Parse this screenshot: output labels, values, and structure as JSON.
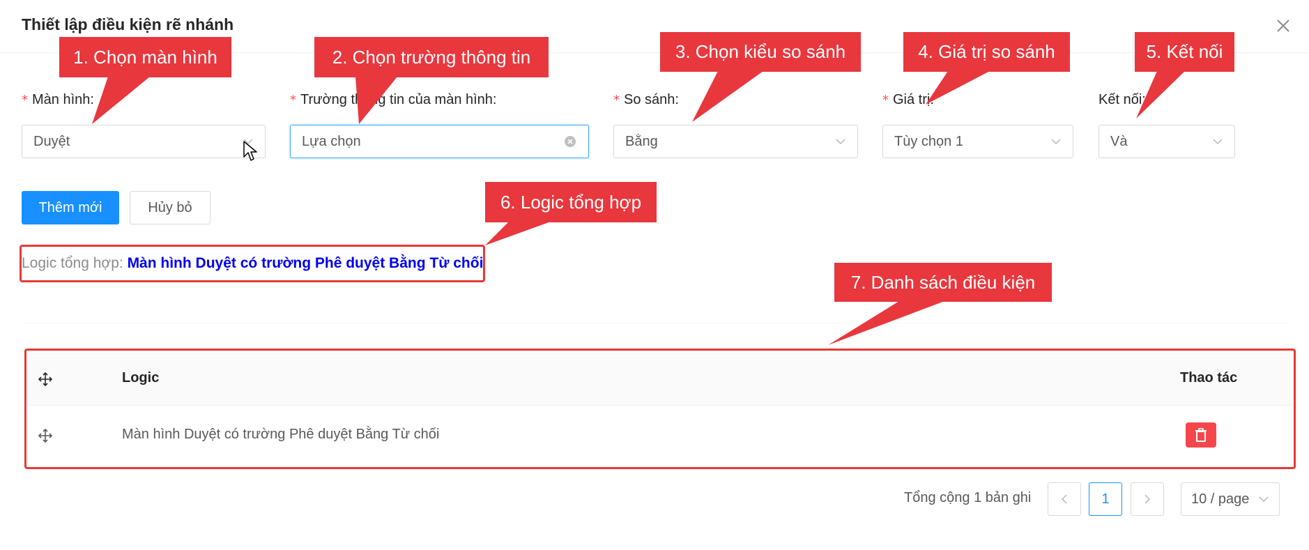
{
  "modal": {
    "title": "Thiết lập điều kiện rẽ nhánh",
    "close_icon": "close-icon"
  },
  "form": {
    "screen": {
      "label": "Màn hình",
      "value": "Duyệt",
      "required": true
    },
    "field": {
      "label": "Trường thông tin của màn hình",
      "value": "Lựa chọn",
      "required": true
    },
    "compare": {
      "label": "So sánh",
      "value": "Bằng",
      "required": true
    },
    "value": {
      "label": "Giá trị",
      "value": "Tùy chọn 1",
      "required": true
    },
    "connect": {
      "label": "Kết nối",
      "value": "Và",
      "required": false
    },
    "required_mark": "*",
    "label_suffix": ":"
  },
  "actions": {
    "add_label": "Thêm mới",
    "cancel_label": "Hủy bỏ"
  },
  "logic_summary": {
    "label": "Logic tổng hợp:",
    "value": "Màn hình Duyệt có trường Phê duyệt Bằng Từ chối"
  },
  "table": {
    "columns": {
      "drag": "drag-icon",
      "logic": "Logic",
      "actions": "Thao tác"
    },
    "rows": [
      {
        "logic": "Màn hình Duyệt có trường Phê duyệt Bằng Từ chối",
        "action": "delete-icon"
      }
    ]
  },
  "pagination": {
    "total_text": "Tổng cộng 1 bản ghi",
    "current_page": "1",
    "page_size": "10 / page"
  },
  "callouts": {
    "c1": "1. Chọn màn hình",
    "c2": "2. Chọn trường thông tin",
    "c3": "3. Chọn kiểu so sánh",
    "c4": "4. Giá trị so sánh",
    "c5": "5. Kết nối",
    "c6": "6. Logic tổng hợp",
    "c7": "7. Danh sách điều kiện"
  },
  "colors": {
    "primary": "#1890ff",
    "danger": "#f5474b",
    "callout": "#e8373d",
    "logic_value": "#0000ee"
  }
}
